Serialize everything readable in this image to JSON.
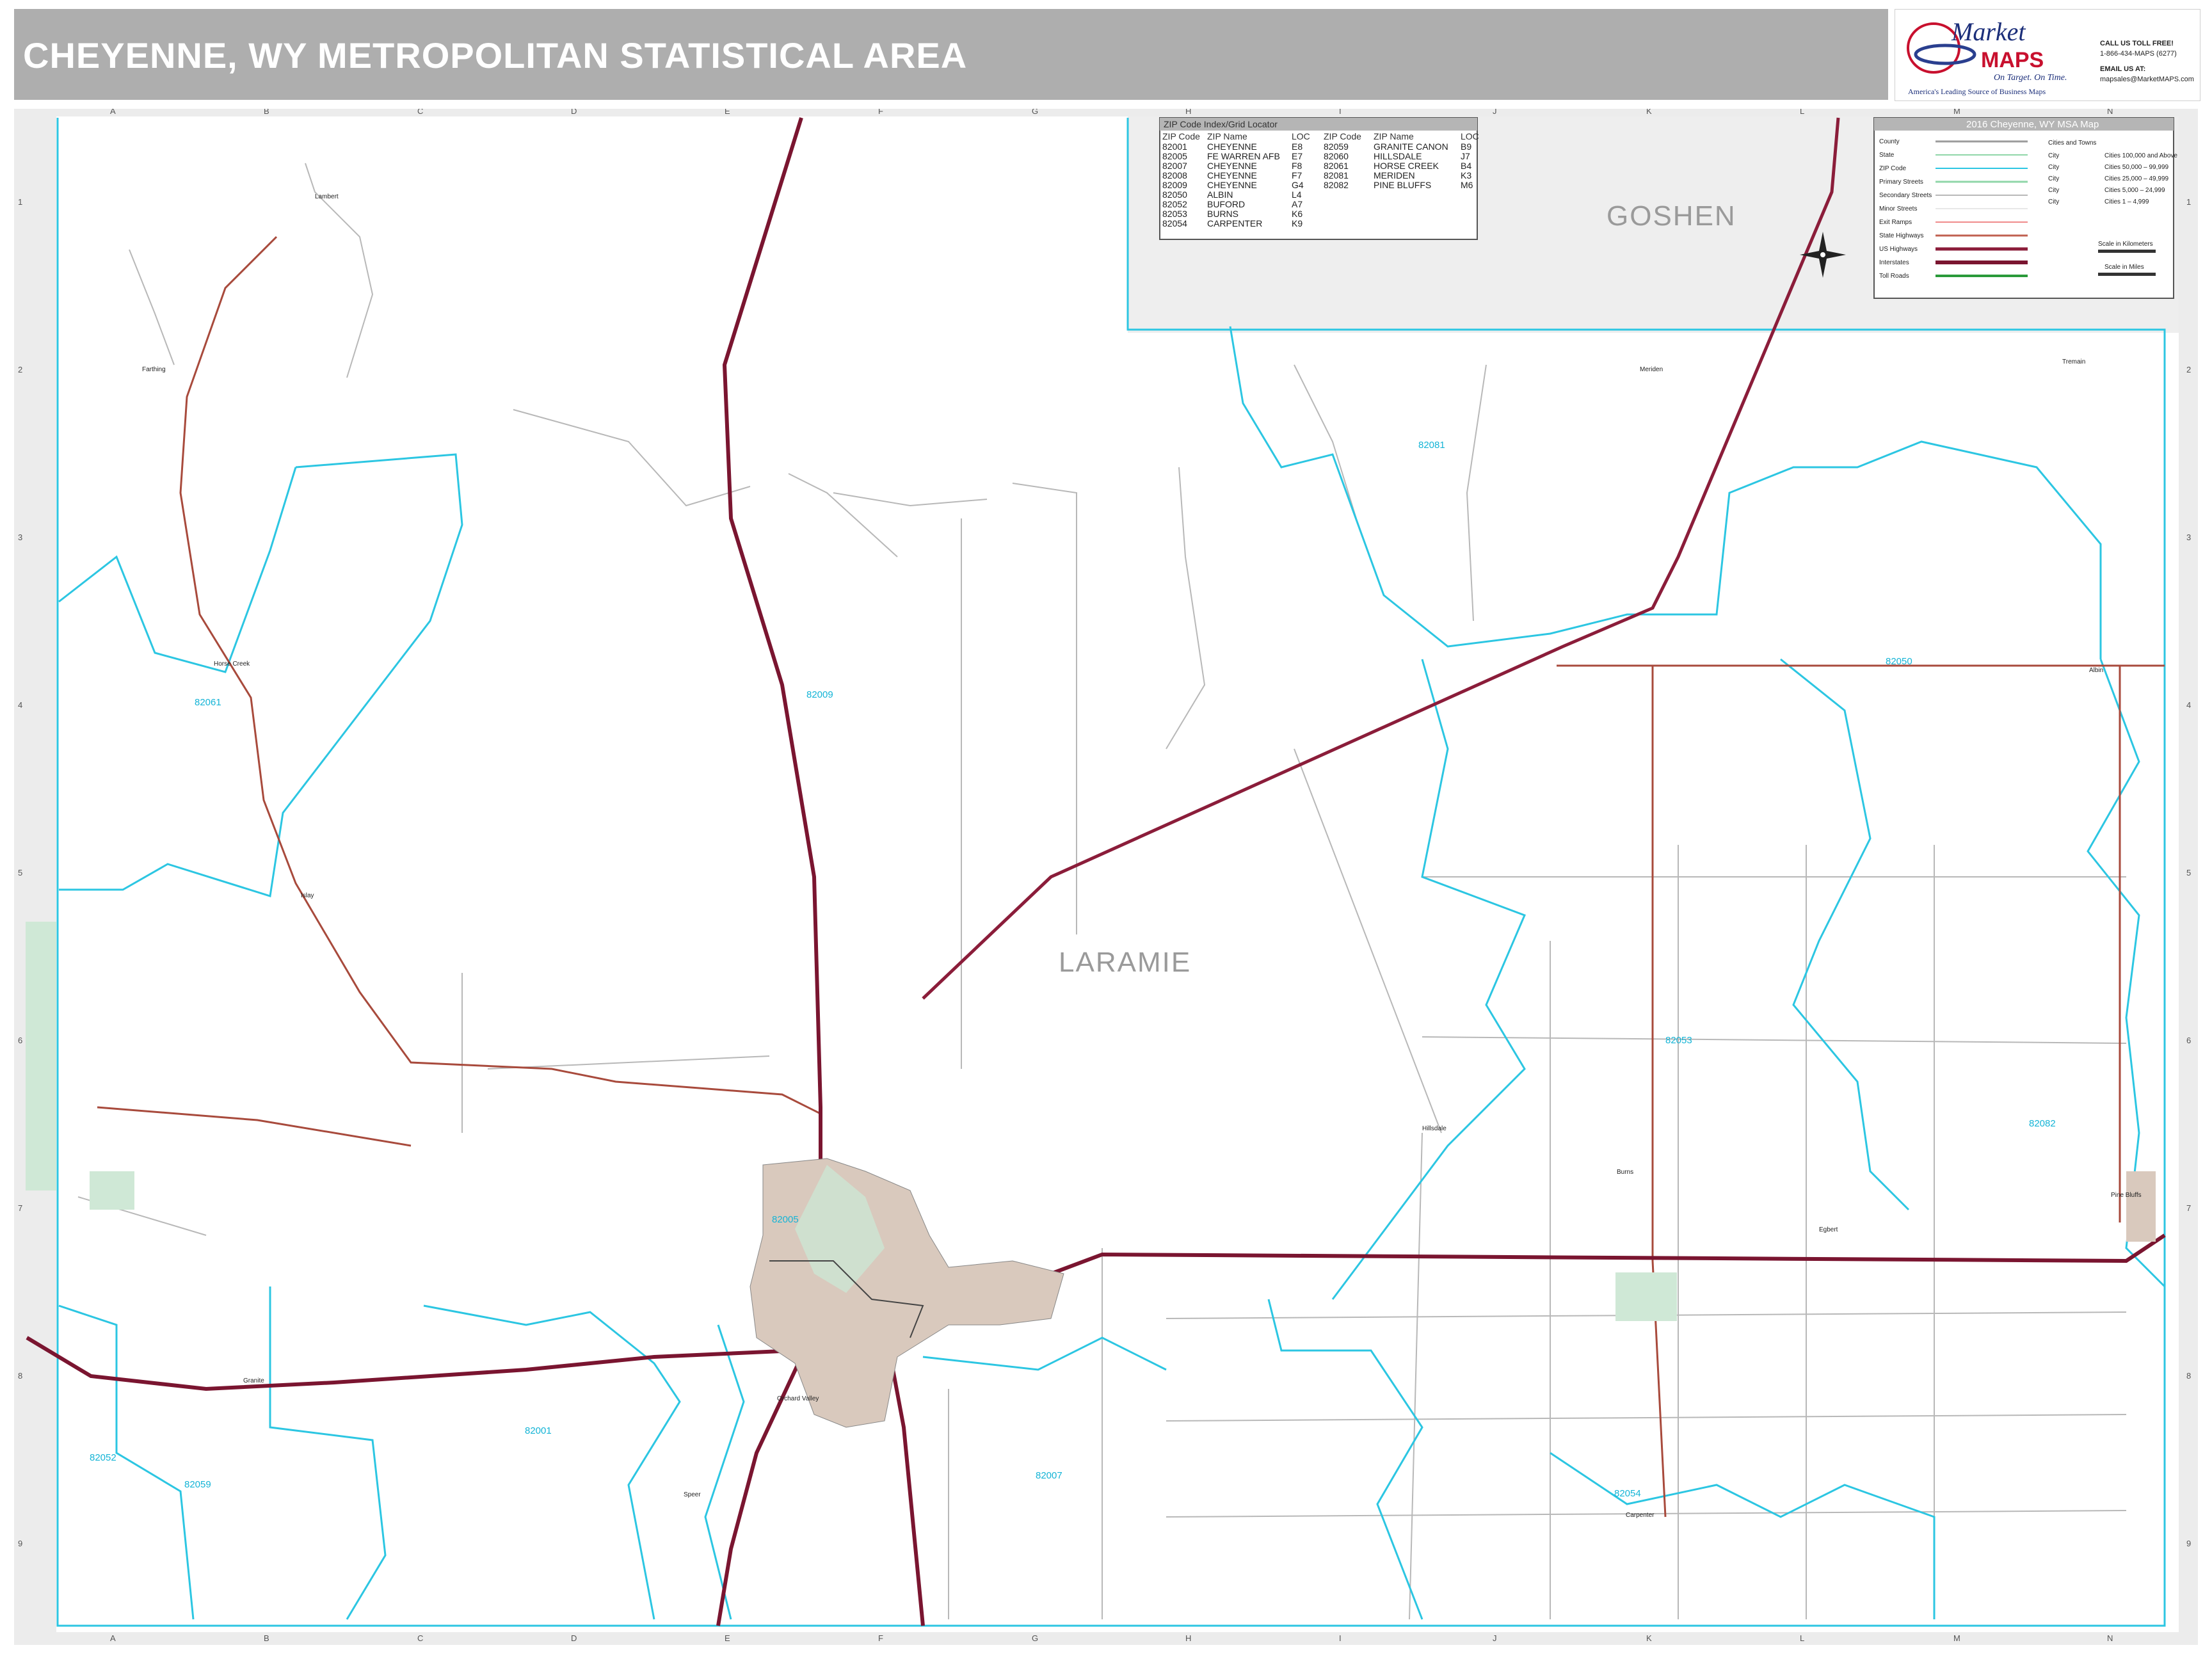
{
  "title": "CHEYENNE, WY METROPOLITAN STATISTICAL AREA",
  "logo": {
    "brand_top": "Market",
    "brand_bottom": "MAPS",
    "tagline": "On Target. On Time.",
    "slogan": "America's Leading Source of Business Maps",
    "phone_label": "CALL US TOLL FREE!",
    "phone": "1-866-434-MAPS (6277)",
    "email_label": "EMAIL US AT:",
    "email": "mapsales@MarketMAPS.com"
  },
  "grid": {
    "columns": [
      "A",
      "B",
      "C",
      "D",
      "E",
      "F",
      "G",
      "H",
      "I",
      "J",
      "K",
      "L",
      "M",
      "N"
    ],
    "rows": [
      "1",
      "2",
      "3",
      "4",
      "5",
      "6",
      "7",
      "8",
      "9"
    ]
  },
  "zip_index": {
    "title": "ZIP Code Index/Grid Locator",
    "headers": [
      "ZIP Code",
      "ZIP Name",
      "LOC",
      "ZIP Code",
      "ZIP Name",
      "LOC"
    ],
    "left": [
      [
        "82001",
        "CHEYENNE",
        "E8"
      ],
      [
        "82005",
        "FE WARREN AFB",
        "E7"
      ],
      [
        "82007",
        "CHEYENNE",
        "F8"
      ],
      [
        "82008",
        "CHEYENNE",
        "F7"
      ],
      [
        "82009",
        "CHEYENNE",
        "G4"
      ],
      [
        "82050",
        "ALBIN",
        "L4"
      ],
      [
        "82052",
        "BUFORD",
        "A7"
      ],
      [
        "82053",
        "BURNS",
        "K6"
      ],
      [
        "82054",
        "CARPENTER",
        "K9"
      ]
    ],
    "right": [
      [
        "82059",
        "GRANITE CANON",
        "B9"
      ],
      [
        "82060",
        "HILLSDALE",
        "J7"
      ],
      [
        "82061",
        "HORSE CREEK",
        "B4"
      ],
      [
        "82081",
        "MERIDEN",
        "K3"
      ],
      [
        "82082",
        "PINE BLUFFS",
        "M6"
      ]
    ]
  },
  "legend": {
    "title": "2016 Cheyenne, WY MSA Map",
    "items": [
      "County",
      "State",
      "ZIP Code",
      "Primary Streets",
      "Secondary Streets",
      "Minor Streets",
      "Exit Ramps",
      "State Highways",
      "US Highways",
      "Interstates",
      "Toll Roads"
    ],
    "cities_title": "Cities and Towns",
    "city_word": "City",
    "city_classes": [
      "Cities 100,000 and Above",
      "Cities 50,000 – 99,999",
      "Cities 25,000 – 49,999",
      "Cities 5,000 – 24,999",
      "Cities 1 – 4,999"
    ],
    "scale_km": "Scale in Kilometers",
    "scale_mi": "Scale in Miles"
  },
  "counties": [
    "GOSHEN",
    "LARAMIE"
  ],
  "zip_labels": [
    "82081",
    "82009",
    "82061",
    "82050",
    "82053",
    "82082",
    "82005",
    "82001",
    "82052",
    "82059",
    "82007",
    "82054"
  ],
  "towns": [
    "Lambert",
    "Farthing",
    "Horse Creek",
    "Islay",
    "Meriden",
    "Tremain",
    "Albin",
    "Burns",
    "Hillsdale",
    "Egbert",
    "Pine Bluffs",
    "Granite",
    "Orchard Valley",
    "Carpenter",
    "Speer"
  ],
  "colors": {
    "interstate": "#7a1530",
    "us_highway": "#8b1d3a",
    "state_highway": "#a84a3c",
    "zip_boundary": "#2cc6e2",
    "county_line": "#9b9b9b",
    "minor_street": "#b8b8b8",
    "city_fill": "#d9c9bd",
    "park_fill": "#cfe8d6",
    "title_bar": "#aeaeae"
  }
}
